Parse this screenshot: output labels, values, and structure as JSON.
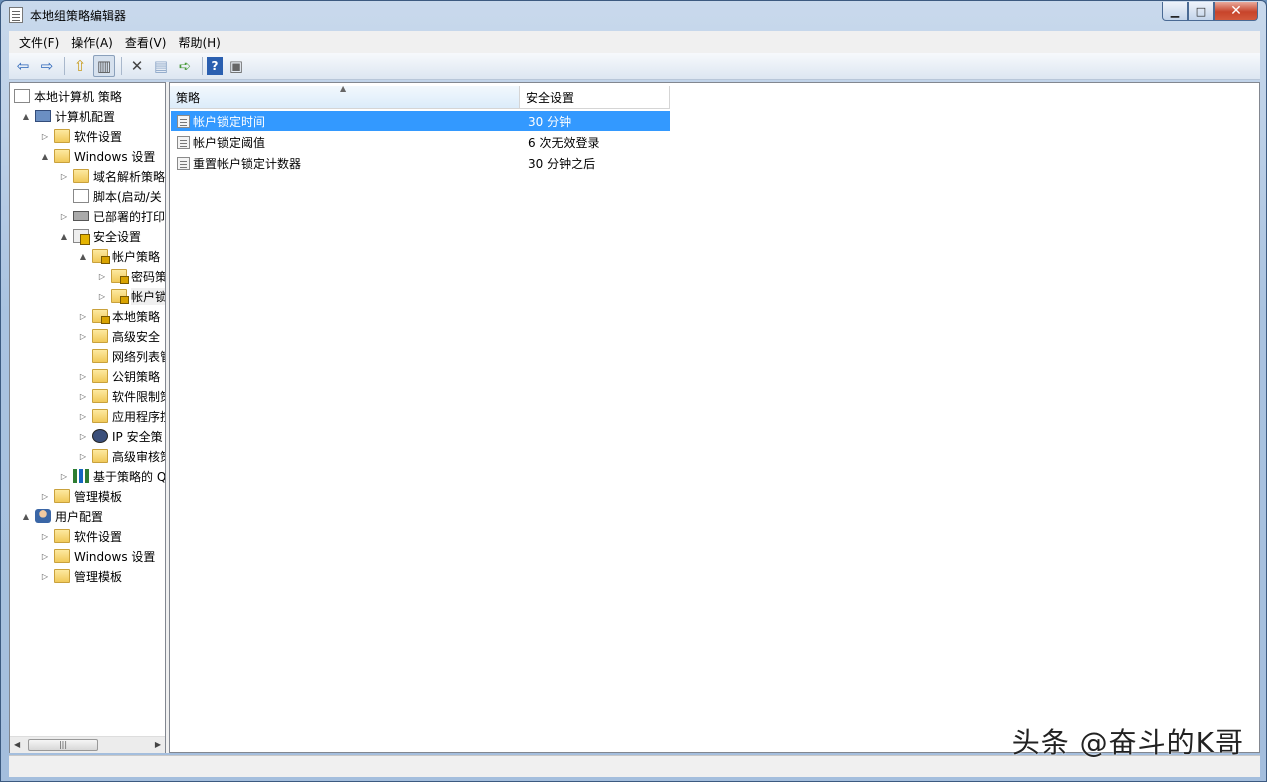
{
  "window": {
    "title": "本地组策略编辑器"
  },
  "menu": [
    "文件(F)",
    "操作(A)",
    "查看(V)",
    "帮助(H)"
  ],
  "tree": [
    {
      "label": "本地计算机 策略",
      "level": 0,
      "icon": "doc-icon",
      "twisty": ""
    },
    {
      "label": "计算机配置",
      "level": 1,
      "icon": "computer-icon",
      "twisty": "▲"
    },
    {
      "label": "软件设置",
      "level": 2,
      "icon": "folder-icon",
      "twisty": "▷"
    },
    {
      "label": "Windows 设置",
      "level": 2,
      "icon": "folder-icon",
      "twisty": "▲"
    },
    {
      "label": "域名解析策略",
      "level": 3,
      "icon": "folder-icon",
      "twisty": "▷"
    },
    {
      "label": "脚本(启动/关",
      "level": 3,
      "icon": "script-icon",
      "twisty": ""
    },
    {
      "label": "已部署的打印",
      "level": 3,
      "icon": "printer-icon",
      "twisty": "▷"
    },
    {
      "label": "安全设置",
      "level": 3,
      "icon": "security-icon",
      "twisty": "▲"
    },
    {
      "label": "帐户策略",
      "level": 4,
      "icon": "lock-folder-icon",
      "twisty": "▲"
    },
    {
      "label": "密码策",
      "level": 5,
      "icon": "lock-folder-icon",
      "twisty": "▷"
    },
    {
      "label": "帐户锁",
      "level": 5,
      "icon": "lock-folder-icon",
      "twisty": "▷",
      "selected": true
    },
    {
      "label": "本地策略",
      "level": 4,
      "icon": "lock-folder-icon",
      "twisty": "▷"
    },
    {
      "label": "高级安全",
      "level": 4,
      "icon": "folder-icon",
      "twisty": "▷"
    },
    {
      "label": "网络列表管",
      "level": 4,
      "icon": "folder-icon",
      "twisty": ""
    },
    {
      "label": "公钥策略",
      "level": 4,
      "icon": "folder-icon",
      "twisty": "▷"
    },
    {
      "label": "软件限制策",
      "level": 4,
      "icon": "folder-icon",
      "twisty": "▷"
    },
    {
      "label": "应用程序控",
      "level": 4,
      "icon": "folder-icon",
      "twisty": "▷"
    },
    {
      "label": "IP 安全策",
      "level": 4,
      "icon": "network-icon",
      "twisty": "▷"
    },
    {
      "label": "高级审核策",
      "level": 4,
      "icon": "folder-icon",
      "twisty": "▷"
    },
    {
      "label": "基于策略的 Q",
      "level": 3,
      "icon": "chart-icon",
      "twisty": "▷"
    },
    {
      "label": "管理模板",
      "level": 2,
      "icon": "folder-icon",
      "twisty": "▷"
    },
    {
      "label": "用户配置",
      "level": 1,
      "icon": "user-icon",
      "twisty": "▲"
    },
    {
      "label": "软件设置",
      "level": 2,
      "icon": "folder-icon",
      "twisty": "▷"
    },
    {
      "label": "Windows 设置",
      "level": 2,
      "icon": "folder-icon",
      "twisty": "▷"
    },
    {
      "label": "管理模板",
      "level": 2,
      "icon": "folder-icon",
      "twisty": "▷"
    }
  ],
  "list": {
    "columns": [
      "策略",
      "安全设置"
    ],
    "rows": [
      {
        "policy": "帐户锁定时间",
        "setting": "30 分钟",
        "selected": true
      },
      {
        "policy": "帐户锁定阈值",
        "setting": "6 次无效登录"
      },
      {
        "policy": "重置帐户锁定计数器",
        "setting": "30 分钟之后"
      }
    ]
  },
  "watermark": "头条 @奋斗的K哥"
}
